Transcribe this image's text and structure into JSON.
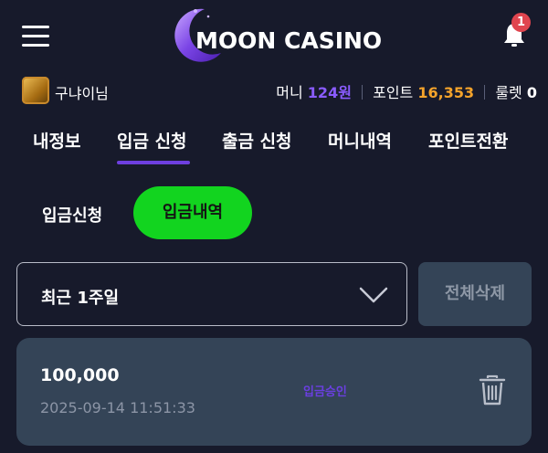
{
  "header": {
    "logo_text": "MOON CASINO",
    "notification_count": "1"
  },
  "user": {
    "name": "구냐이님",
    "money_label": "머니",
    "money_value": "124원",
    "point_label": "포인트",
    "point_value": "16,353",
    "roulette_label": "룰렛",
    "roulette_value": "0"
  },
  "tabs": [
    {
      "label": "내정보",
      "active": false
    },
    {
      "label": "입금 신청",
      "active": true
    },
    {
      "label": "출금 신청",
      "active": false
    },
    {
      "label": "머니내역",
      "active": false
    },
    {
      "label": "포인트전환",
      "active": false
    }
  ],
  "subtabs": {
    "request_label": "입금신청",
    "history_label": "입금내역"
  },
  "filter": {
    "period_value": "최근 1주일",
    "delete_all_label": "전체삭제"
  },
  "records": [
    {
      "amount": "100,000",
      "datetime": "2025-09-14 11:51:33",
      "status": "입금승인"
    }
  ],
  "colors": {
    "background": "#171a2b",
    "accent_purple": "#6e3fe0",
    "money": "#8a5cff",
    "point": "#f4a32b",
    "active_green": "#12d41f",
    "card": "#344457",
    "badge_red": "#e0454f"
  },
  "icons": {
    "menu": "hamburger-icon",
    "notifications": "bell-icon",
    "dropdown": "chevron-down-icon",
    "delete": "trash-icon",
    "logo": "crescent-moon-icon"
  }
}
